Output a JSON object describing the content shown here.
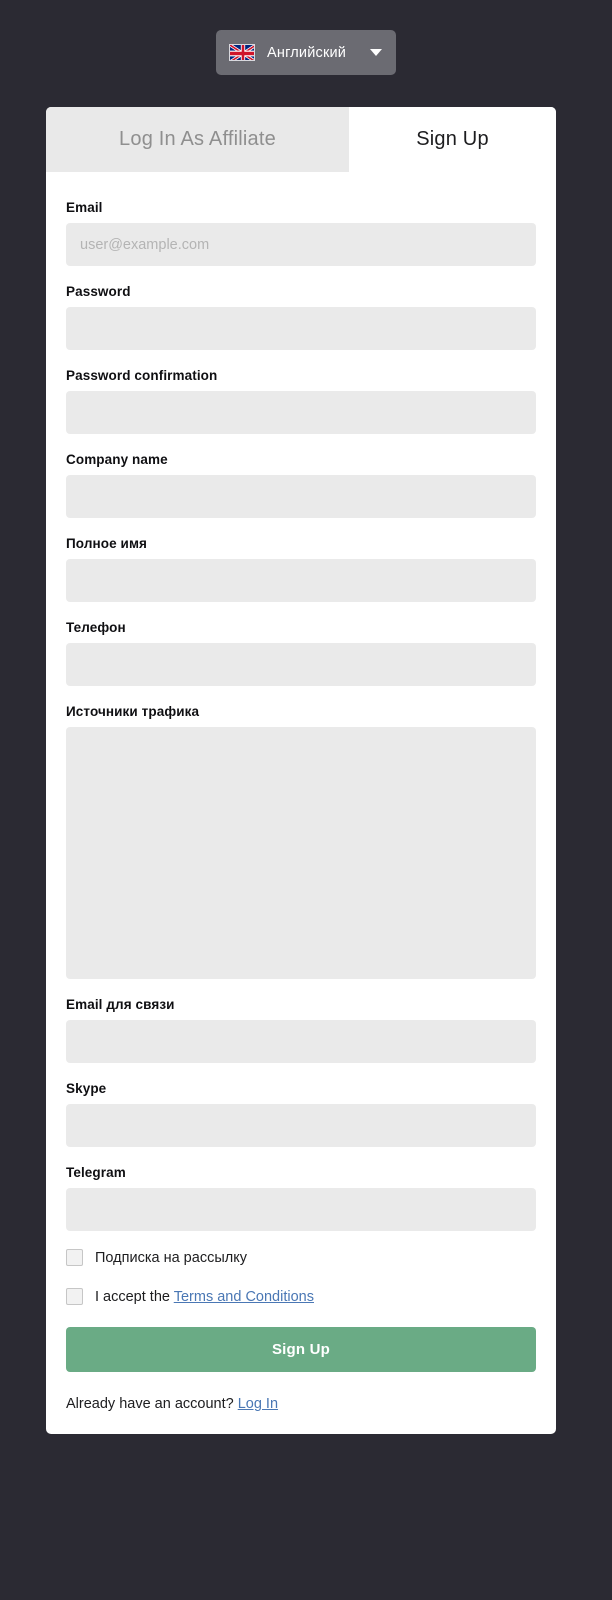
{
  "language_selector": {
    "flag_icon": "uk-flag-icon",
    "label": "Английский",
    "caret_icon": "chevron-down-icon"
  },
  "card": {
    "tabs": [
      {
        "id": "login",
        "label": "Log In As Affiliate",
        "active": false
      },
      {
        "id": "signup",
        "label": "Sign Up",
        "active": true
      }
    ],
    "fields": [
      {
        "id": "email",
        "label": "Email",
        "value": "",
        "placeholder": "user@example.com",
        "type": "input"
      },
      {
        "id": "password",
        "label": "Password",
        "value": "",
        "placeholder": "",
        "type": "input"
      },
      {
        "id": "password_confirmation",
        "label": "Password confirmation",
        "value": "",
        "placeholder": "",
        "type": "input"
      },
      {
        "id": "company_name",
        "label": "Company name",
        "value": "",
        "placeholder": "",
        "type": "input"
      },
      {
        "id": "full_name",
        "label": "Полное имя",
        "value": "",
        "placeholder": "",
        "type": "input"
      },
      {
        "id": "phone",
        "label": "Телефон",
        "value": "",
        "placeholder": "",
        "type": "input"
      },
      {
        "id": "traffic_sources",
        "label": "Источники трафика",
        "value": "",
        "placeholder": "",
        "type": "textarea"
      },
      {
        "id": "contact_email",
        "label": "Email для связи",
        "value": "",
        "placeholder": "",
        "type": "input"
      },
      {
        "id": "skype",
        "label": "Skype",
        "value": "",
        "placeholder": "",
        "type": "input"
      },
      {
        "id": "telegram",
        "label": "Telegram",
        "value": "",
        "placeholder": "",
        "type": "input"
      }
    ],
    "checkboxes": {
      "newsletter": {
        "label": "Подписка на рассылку",
        "checked": false
      },
      "terms": {
        "prefix": "I accept the ",
        "link_text": "Terms and Conditions",
        "checked": false
      }
    },
    "submit_label": "Sign Up",
    "footer": {
      "text": "Already have an account? ",
      "link_text": "Log In"
    }
  },
  "colors": {
    "page_background": "#2b2a33",
    "card_background": "#ffffff",
    "input_background": "#eaeaea",
    "inactive_tab_background": "#e9e9e9",
    "accent_green": "#6aab85",
    "link_blue": "#4a77b4",
    "lang_pill": "#6b6b72"
  }
}
